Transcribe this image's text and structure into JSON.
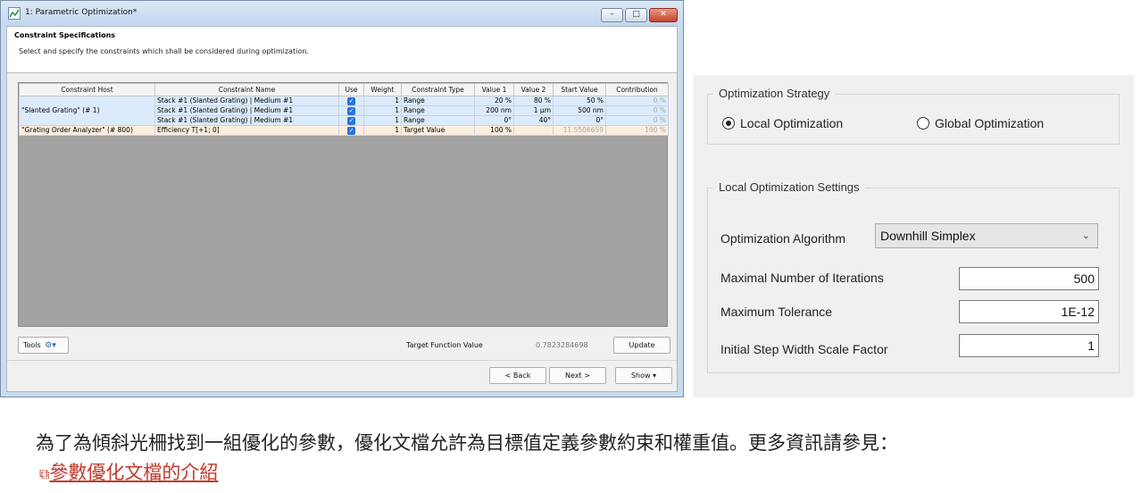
{
  "window": {
    "title": "1: Parametric Optimization*",
    "minimize": "–",
    "maximize": "□",
    "close": "✕"
  },
  "header": {
    "title": "Constraint Specifications",
    "description": "Select and specify the constraints which shall be considered during optimization."
  },
  "table": {
    "columns": [
      "Constraint Host",
      "Constraint Name",
      "Use",
      "Weight",
      "Constraint Type",
      "Value 1",
      "Value 2",
      "Start Value",
      "Contribution"
    ],
    "host1": "\"Slanted Grating\" (# 1)",
    "rows": [
      {
        "name": "Stack #1 (Slanted Grating) | Medium #1",
        "use": "✓",
        "weight": "1",
        "type": "Range",
        "v1": "20 %",
        "v2": "80 %",
        "start": "50 %",
        "contrib": "0 %"
      },
      {
        "name": "Stack #1 (Slanted Grating) | Medium #1",
        "use": "✓",
        "weight": "1",
        "type": "Range",
        "v1": "200 nm",
        "v2": "1 µm",
        "start": "500 nm",
        "contrib": "0 %"
      },
      {
        "name": "Stack #1 (Slanted Grating) | Medium #1",
        "use": "✓",
        "weight": "1",
        "type": "Range",
        "v1": "0°",
        "v2": "40°",
        "start": "0°",
        "contrib": "0 %"
      }
    ],
    "row4": {
      "host": "\"Grating Order Analyzer\" (# 800)",
      "name": "Efficiency T[+1; 0]",
      "use": "✓",
      "weight": "1",
      "type": "Target Value",
      "v1": "100 %",
      "v2": "",
      "start": "11.5506659",
      "contrib": "100 %"
    }
  },
  "footer": {
    "tools_label": "Tools",
    "tfv_label": "Target Function Value",
    "tfv_value": "0.7823284698",
    "update_label": "Update",
    "back_label": "< Back",
    "next_label": "Next >",
    "show_label": "Show ▾"
  },
  "settings": {
    "strategy_title": "Optimization Strategy",
    "local_opt": "Local Optimization",
    "global_opt": "Global Optimization",
    "local_settings_title": "Local Optimization Settings",
    "algorithm_label": "Optimization Algorithm",
    "algorithm_value": "Downhill Simplex",
    "max_iter_label": "Maximal Number of Iterations",
    "max_iter_value": "500",
    "max_tol_label": "Maximum Tolerance",
    "max_tol_value": "1E-12",
    "step_label": "Initial Step Width Scale Factor",
    "step_value": "1"
  },
  "caption": {
    "text": "為了為傾斜光柵找到一組優化的參數，優化文檔允許為目標值定義參數約束和權重值。更多資訊請參見：",
    "link_text": "參數優化文檔的介紹"
  }
}
